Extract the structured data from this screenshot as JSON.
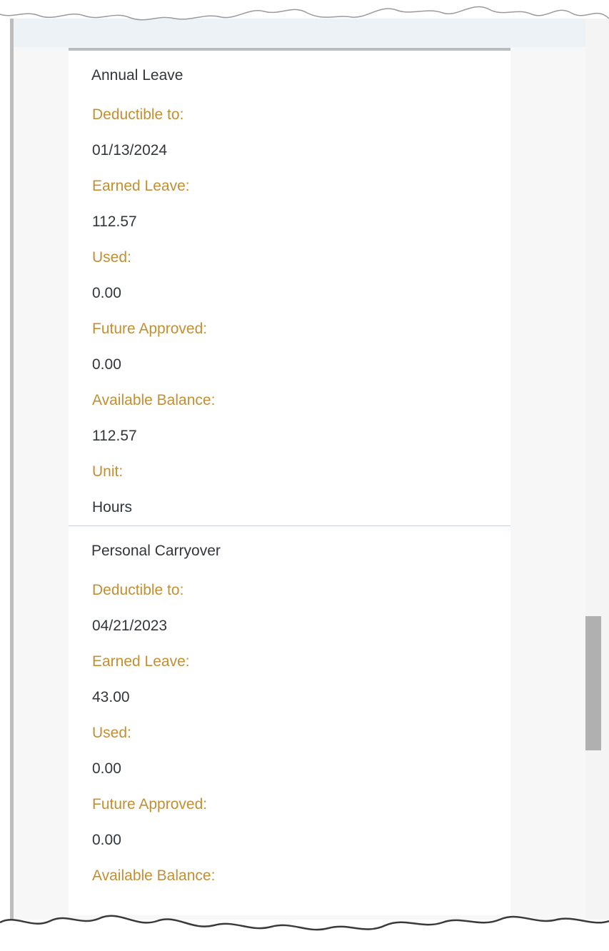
{
  "colors": {
    "label": "#c18f34",
    "value": "#32363a",
    "divider": "#c8cdd6"
  },
  "groups": [
    {
      "title": "Annual Leave",
      "rows": [
        {
          "label": "Deductible to:",
          "value": "01/13/2024"
        },
        {
          "label": "Earned Leave:",
          "value": "112.57"
        },
        {
          "label": "Used:",
          "value": "0.00"
        },
        {
          "label": "Future Approved:",
          "value": "0.00"
        },
        {
          "label": "Available Balance:",
          "value": "112.57"
        },
        {
          "label": "Unit:",
          "value": "Hours"
        }
      ]
    },
    {
      "title": "Personal Carryover",
      "rows": [
        {
          "label": "Deductible to:",
          "value": "04/21/2023"
        },
        {
          "label": "Earned Leave:",
          "value": "43.00"
        },
        {
          "label": "Used:",
          "value": "0.00"
        },
        {
          "label": "Future Approved:",
          "value": "0.00"
        },
        {
          "label": "Available Balance:"
        }
      ]
    }
  ]
}
